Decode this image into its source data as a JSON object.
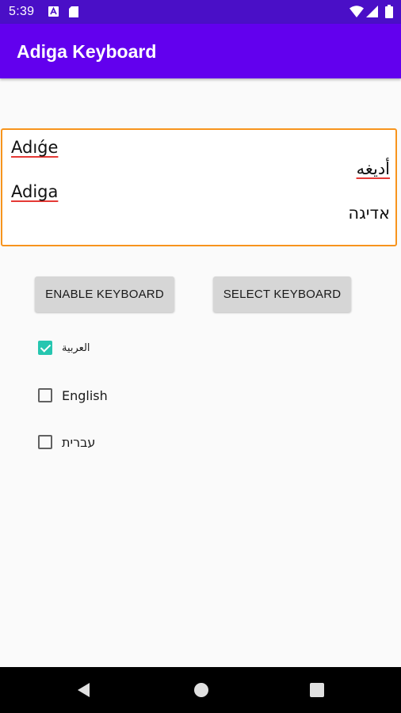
{
  "status_bar": {
    "time": "5:39",
    "icons": [
      "a-notification-icon",
      "sd-card-icon",
      "wifi-icon",
      "signal-icon",
      "battery-icon"
    ],
    "background": "#4a0fc7"
  },
  "app_bar": {
    "title": "Adiga Keyboard",
    "background": "#6200ee"
  },
  "text_box": {
    "lines": [
      "Adıǵe",
      "أديغه",
      "Adiga",
      "אדיגה"
    ],
    "border_color": "#f7941d"
  },
  "buttons": {
    "enable_label": "ENABLE KEYBOARD",
    "select_label": "SELECT KEYBOARD"
  },
  "languages": [
    {
      "label": "العربية",
      "checked": true
    },
    {
      "label": "English",
      "checked": false
    },
    {
      "label": "עברית",
      "checked": false
    }
  ],
  "checkbox_color": "#26c6b0",
  "nav_bar": {
    "icons": [
      "back-icon",
      "home-icon",
      "recents-icon"
    ]
  }
}
